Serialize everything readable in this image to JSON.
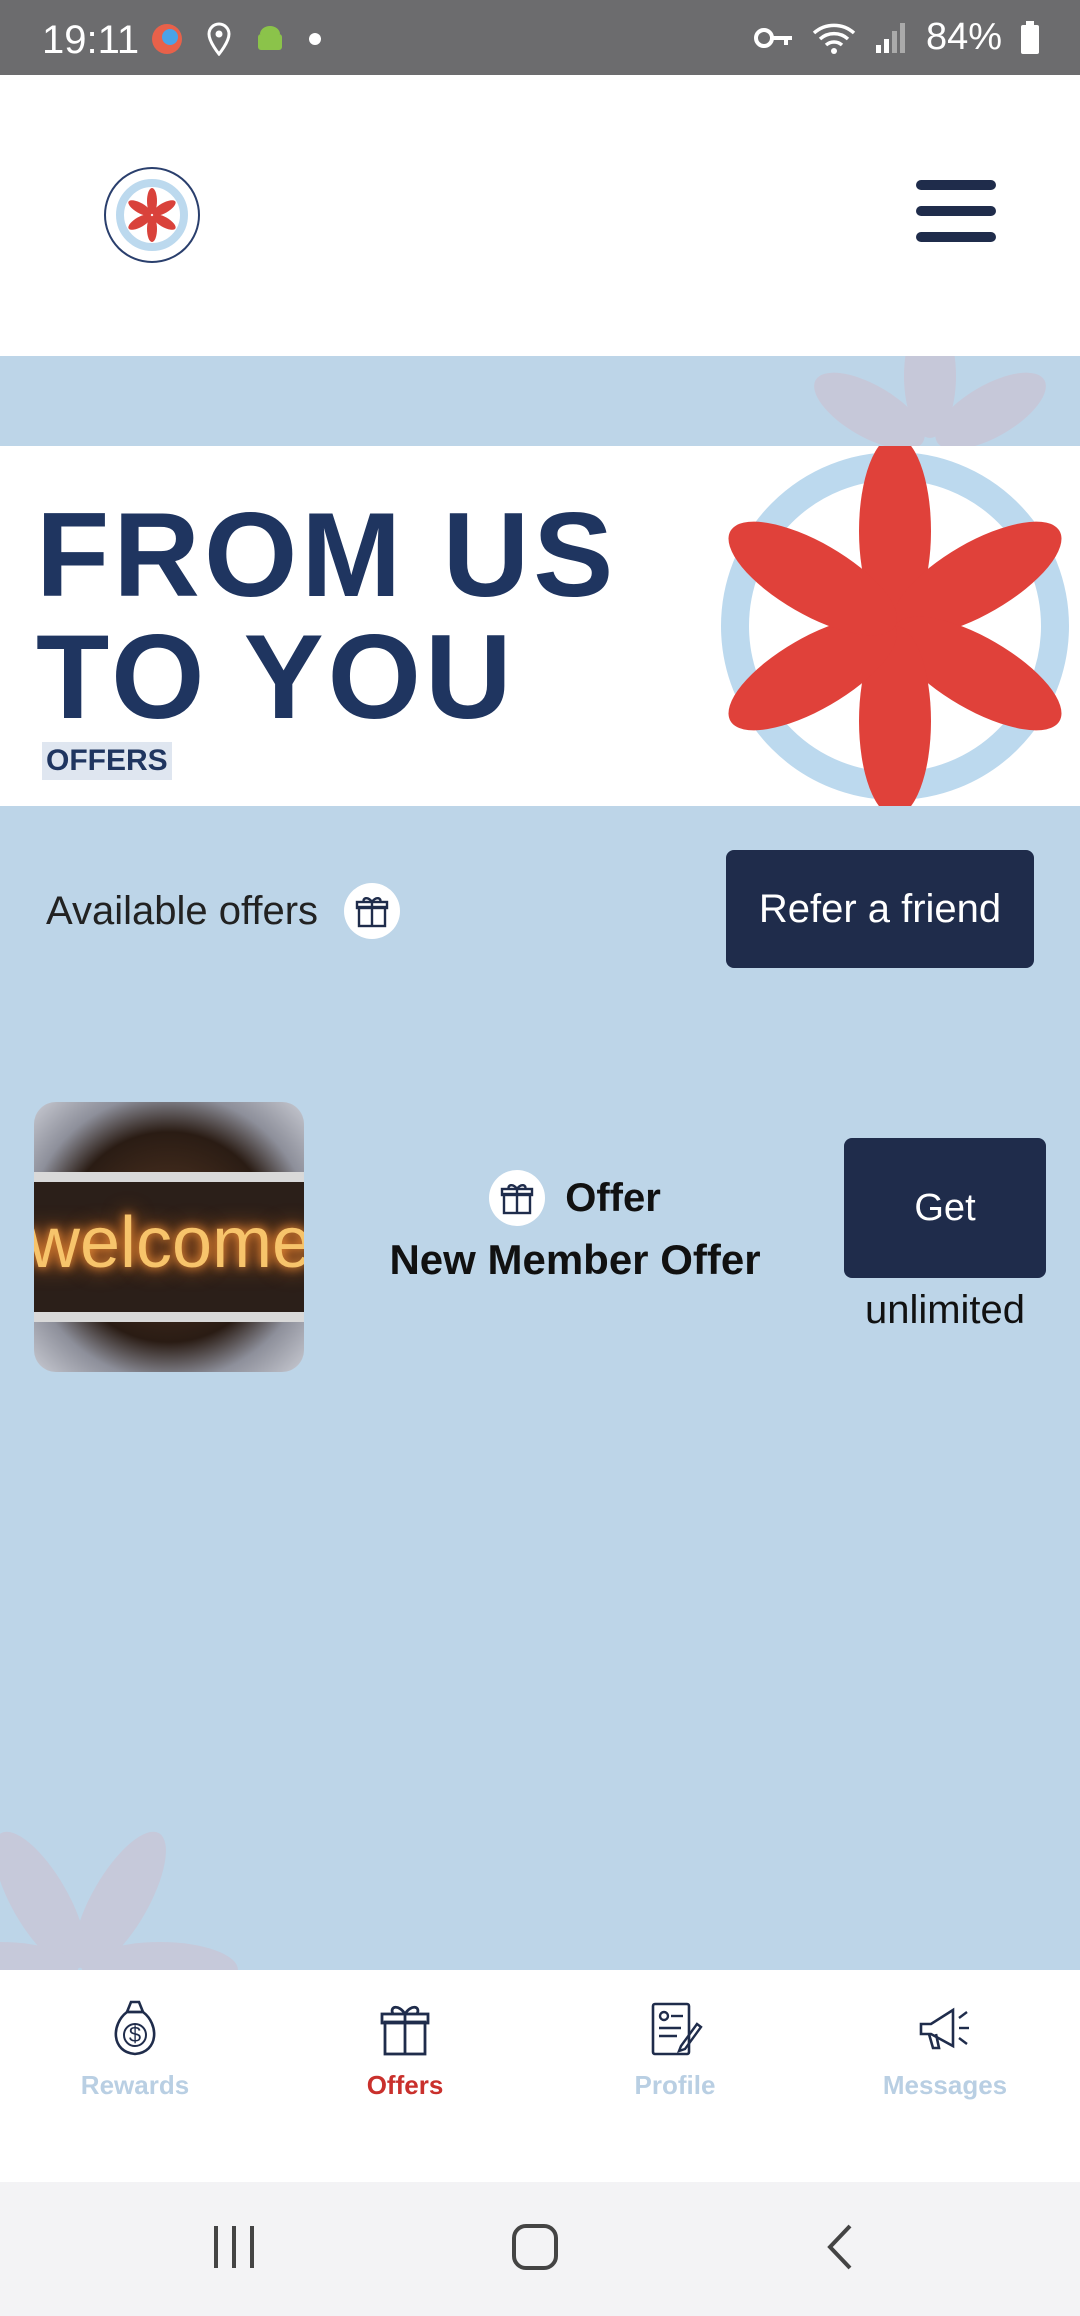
{
  "status_bar": {
    "time": "19:11",
    "battery": "84%"
  },
  "header": {
    "logo_alt": "Windy City Cannabis",
    "menu_icon": "hamburger-menu-icon"
  },
  "banner": {
    "title_line1": "FROM US",
    "title_line2": "TO YOU",
    "subtitle": "OFFERS"
  },
  "offers_section": {
    "label": "Available offers",
    "refer_button": "Refer a friend"
  },
  "offers": [
    {
      "thumb_text": "welcome",
      "type": "Offer",
      "name": "New Member Offer",
      "button": "Get",
      "limit": "unlimited"
    }
  ],
  "bottom_nav": [
    {
      "label": "Rewards",
      "icon": "money-bag-icon",
      "active": false
    },
    {
      "label": "Offers",
      "icon": "gift-icon",
      "active": true
    },
    {
      "label": "Profile",
      "icon": "profile-form-icon",
      "active": false
    },
    {
      "label": "Messages",
      "icon": "megaphone-icon",
      "active": false
    }
  ],
  "colors": {
    "primary": "#1f2c4b",
    "accent": "#c9302c",
    "background": "#bdd5e8"
  }
}
